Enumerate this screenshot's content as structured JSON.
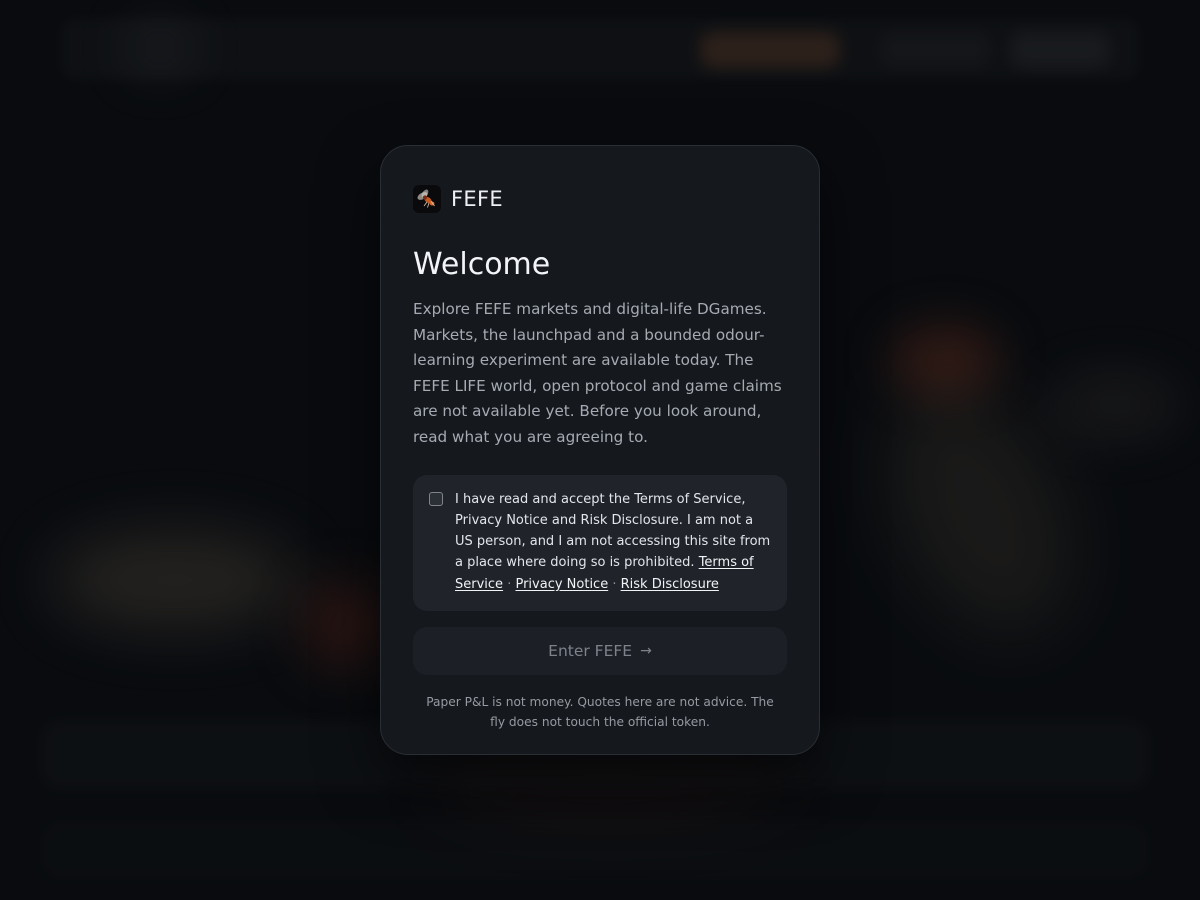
{
  "brand": {
    "name": "FEFE",
    "logo_icon": "fly-icon"
  },
  "welcome": {
    "title": "Welcome",
    "intro": "Explore FEFE markets and digital-life DGames. Markets, the launchpad and a bounded odour-learning experiment are available today. The FEFE LIFE world, open protocol and game claims are not available yet. Before you look around, read what you are agreeing to."
  },
  "consent": {
    "checked": false,
    "statement": "I have read and accept the Terms of Service, Privacy Notice and Risk Disclosure. I am not a US person, and I am not accessing this site from a place where doing so is prohibited.",
    "links": {
      "terms": "Terms of Service",
      "privacy": "Privacy Notice",
      "risk": "Risk Disclosure"
    },
    "separator": "·"
  },
  "enter_button": {
    "label": "Enter FEFE",
    "icon": "arrow-right-icon",
    "disabled": true
  },
  "disclaimer": "Paper P&L is not money. Quotes here are not advice. The fly does not touch the official token.",
  "colors": {
    "background": "#0b0d11",
    "card": "#15181d",
    "consent_box": "#20242a",
    "button_disabled": "#1c1f25",
    "accent_glow": "#c0552a"
  }
}
